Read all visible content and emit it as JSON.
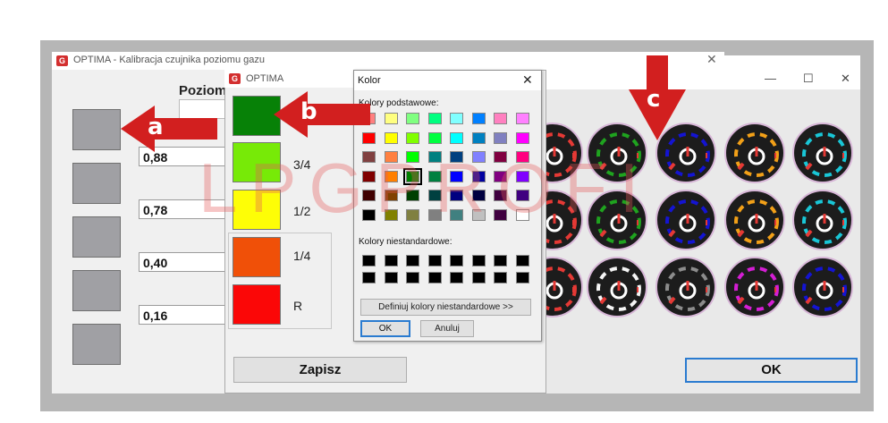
{
  "main_window": {
    "title": "OPTIMA - Kalibracja czujnika poziomu gazu",
    "close_glyph": "✕",
    "poziom_label": "Poziom",
    "fields": [
      "0,88",
      "0,78",
      "0,40",
      "0,16"
    ]
  },
  "optima_window": {
    "title": "OPTIMA",
    "levels": [
      {
        "label": "",
        "color": "#078107"
      },
      {
        "label": "3/4",
        "color": "#77ea07"
      },
      {
        "label": "1/2",
        "color": "#fefe06"
      },
      {
        "label": "1/4",
        "color": "#f05008"
      },
      {
        "label": "R",
        "color": "#fb0707"
      }
    ],
    "save_label": "Zapisz"
  },
  "color_dialog": {
    "title": "Kolor",
    "close_glyph": "✕",
    "basic_label": "Kolory podstawowe:",
    "custom_label": "Kolory niestandardowe:",
    "define_label": "Definiuj kolory niestandardowe >>",
    "ok_label": "OK",
    "cancel_label": "Anuluj",
    "selected_color": "#008000",
    "basic_colors": [
      [
        "#ff8080",
        "#ffff80",
        "#80ff80",
        "#00ff80",
        "#80ffff",
        "#0080ff",
        "#ff80c0",
        "#ff80ff"
      ],
      [
        "#ff0000",
        "#ffff00",
        "#80ff00",
        "#00ff40",
        "#00ffff",
        "#0080c0",
        "#8080c0",
        "#ff00ff"
      ],
      [
        "#804040",
        "#ff8040",
        "#00ff00",
        "#008080",
        "#004080",
        "#8080ff",
        "#800040",
        "#ff0080"
      ],
      [
        "#800000",
        "#ff8000",
        "#008000",
        "#008040",
        "#0000ff",
        "#0000a0",
        "#800080",
        "#8000ff"
      ],
      [
        "#400000",
        "#804000",
        "#004000",
        "#004040",
        "#000080",
        "#000040",
        "#400040",
        "#400080"
      ],
      [
        "#000000",
        "#808000",
        "#808040",
        "#808080",
        "#408080",
        "#c0c0c0",
        "#400040",
        "#ffffff"
      ]
    ]
  },
  "gauge_window": {
    "minimize_glyph": "—",
    "maximize_glyph": "☐",
    "close_glyph": "✕",
    "ok_label": "OK",
    "gauge_colors": [
      [
        "#e53935",
        "#1fa31f",
        "#1414d2",
        "#f2a018",
        "#19c6d6"
      ],
      [
        "#e53935",
        "#1fa31f",
        "#1414d2",
        "#f2a018",
        "#19c6d6"
      ],
      [
        "#e53935",
        "#f5f5f5",
        "#8c8c8c",
        "#d41ed4",
        "#1414d2"
      ]
    ]
  },
  "annotations": {
    "a": "a",
    "b": "b",
    "c": "c",
    "watermark": "LPGPROFI"
  },
  "colors": {
    "arrow": "#d21f1f",
    "accent": "#2a7bd0"
  }
}
